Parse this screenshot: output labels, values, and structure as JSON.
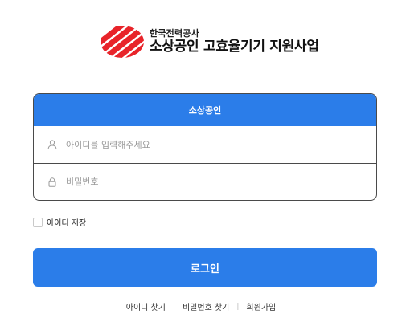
{
  "brand": {
    "org": "한국전력공사",
    "title": "소상공인 고효율기기 지원사업",
    "logo_colors": [
      "#e8242a"
    ]
  },
  "login_card": {
    "header": "소상공인",
    "header_color": "#2b7de9",
    "id_field": {
      "placeholder": "아이디를 입력해주세요",
      "value": "",
      "icon": "user-icon"
    },
    "password_field": {
      "placeholder": "비밀번호",
      "value": "",
      "icon": "lock-icon"
    }
  },
  "save_id": {
    "label": "아이디 저장",
    "checked": false
  },
  "login_button": {
    "label": "로그인",
    "color": "#2b7de9"
  },
  "links": {
    "find_id": "아이디 찾기",
    "separator": "|",
    "find_password": "비밀번호 찾기",
    "signup": "회원가입"
  }
}
